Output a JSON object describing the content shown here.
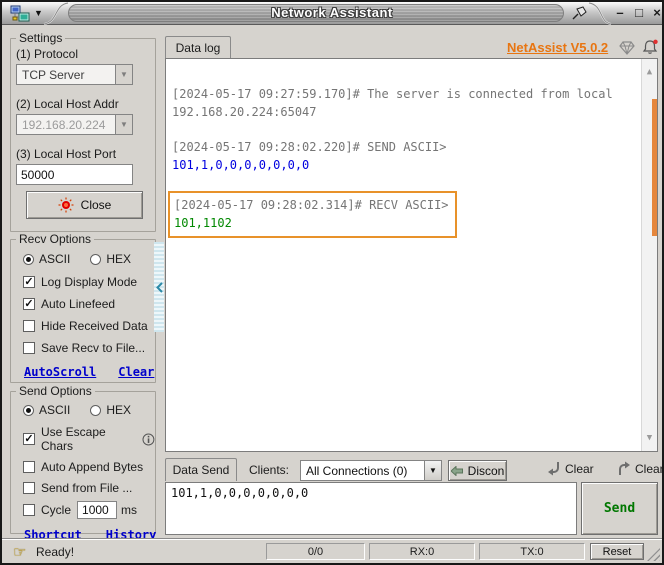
{
  "window": {
    "title": "Network Assistant"
  },
  "header": {
    "tab_label": "Data log",
    "version_link": "NetAssist V5.0.2"
  },
  "settings": {
    "title": "Settings",
    "protocol_label": "(1) Protocol",
    "protocol_value": "TCP Server",
    "addr_label": "(2) Local Host Addr",
    "addr_value": "192.168.20.224",
    "port_label": "(3) Local Host Port",
    "port_value": "50000",
    "close_button": "Close"
  },
  "recv_options": {
    "title": "Recv Options",
    "radio_ascii": {
      "label": "ASCII",
      "selected": true
    },
    "radio_hex": {
      "label": "HEX",
      "selected": false
    },
    "checkboxes": [
      {
        "label": "Log Display Mode",
        "checked": true,
        "mark": "✓"
      },
      {
        "label": "Auto Linefeed",
        "checked": true,
        "mark": "✓"
      },
      {
        "label": "Hide Received Data",
        "checked": false,
        "mark": ""
      },
      {
        "label": "Save Recv to File...",
        "checked": false,
        "mark": ""
      }
    ],
    "link_autoscroll": "AutoScroll",
    "link_clear": "Clear"
  },
  "send_options": {
    "title": "Send Options",
    "radio_ascii": {
      "label": "ASCII",
      "selected": true
    },
    "radio_hex": {
      "label": "HEX",
      "selected": false
    },
    "escape": {
      "label": "Use Escape Chars",
      "checked": true,
      "mark": "✓"
    },
    "append": {
      "label": "Auto Append Bytes",
      "checked": false,
      "mark": ""
    },
    "fromfile": {
      "label": "Send from File ...",
      "checked": false,
      "mark": ""
    },
    "cycle": {
      "label": "Cycle",
      "checked": false,
      "mark": "",
      "value": "1000",
      "unit": "ms"
    },
    "link_shortcut": "Shortcut",
    "link_history": "History"
  },
  "log": {
    "entries": [
      {
        "header": "[2024-05-17 09:27:59.170]# The server is connected from local",
        "body": "192.168.20.224:65047",
        "body_color": "gray",
        "highlighted": false
      },
      {
        "header": "[2024-05-17 09:28:02.220]# SEND ASCII>",
        "body": "101,1,0,0,0,0,0,0,0",
        "body_color": "blue",
        "highlighted": false
      },
      {
        "header": "[2024-05-17 09:28:02.314]# RECV ASCII>",
        "body": "101,1102",
        "body_color": "green",
        "highlighted": true
      }
    ]
  },
  "send_bar": {
    "tab_label": "Data Send",
    "clients_label": "Clients:",
    "clients_value": "All Connections (0)",
    "discon_button": "Discon",
    "clear_down_label": "Clear",
    "clear_up_label": "Clear",
    "send_value": "101,1,0,0,0,0,0,0,0",
    "send_button": "Send"
  },
  "statusbar": {
    "ready_text": "Ready!",
    "counter": "0/0",
    "rx": "RX:0",
    "tx": "TX:0",
    "reset_button": "Reset"
  },
  "colors": {
    "accent_orange": "#e8922a",
    "version_orange": "#e87511",
    "link_blue": "#0000cc",
    "data_blue": "#0000e0",
    "data_green": "#008800",
    "log_gray": "#757575",
    "send_green": "#007700"
  }
}
